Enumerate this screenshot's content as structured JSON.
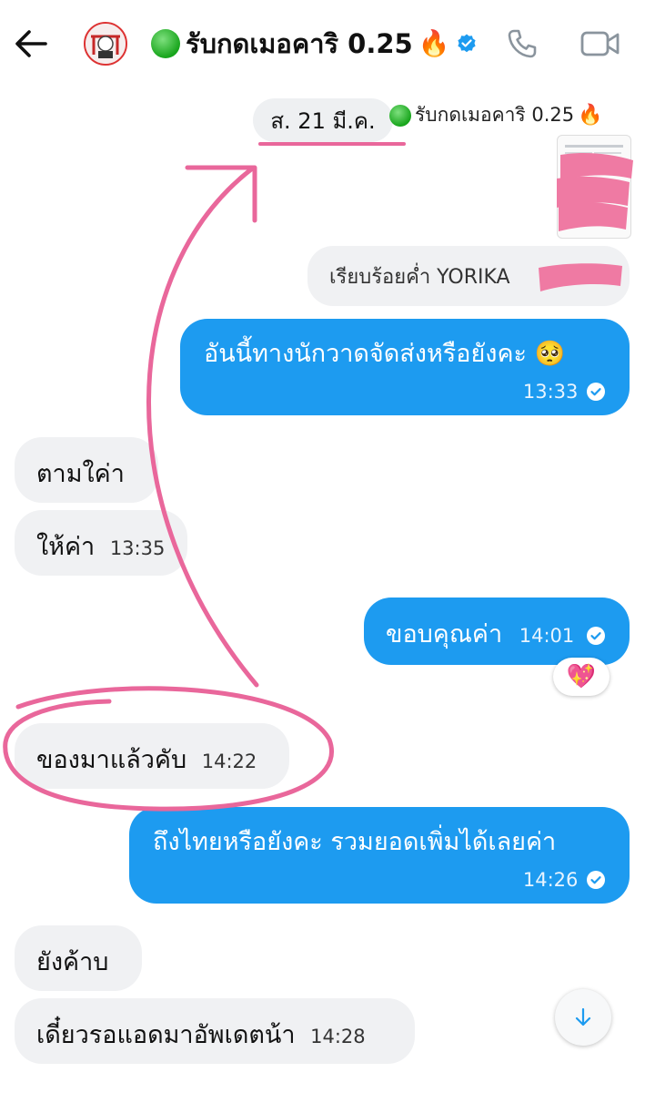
{
  "header": {
    "title": "รับกดเมอคาริ 0.25",
    "title_emoji": "🔥"
  },
  "date_separator": "ส. 21 มี.ค.",
  "shared_post": {
    "channel_name": "รับกดเมอคาริ 0.25",
    "channel_emoji": "🔥",
    "quoted_text": "เรียบร้อยค่ำ YORIKA"
  },
  "messages": [
    {
      "side": "out",
      "text": "อันนี้ทางนักวาดจัดส่งหรือยังคะ 🥺",
      "time": "13:33"
    },
    {
      "side": "in",
      "text": "ตามใค่า",
      "time": ""
    },
    {
      "side": "in",
      "text": "ให้ค่า",
      "time": "13:35"
    },
    {
      "side": "out",
      "text": "ขอบคุณค่า",
      "time": "14:01"
    },
    {
      "side": "in",
      "text": "ของมาแล้วคับ",
      "time": "14:22"
    },
    {
      "side": "out",
      "text": "ถึงไทยหรือยังคะ รวมยอดเพิ่มได้เลยค่า",
      "time": "14:26"
    },
    {
      "side": "in",
      "text": "ยังค้าบ",
      "time": ""
    },
    {
      "side": "in",
      "text": "เดี๋ยวรอแอดมาอัพเดตน้า",
      "time": "14:28"
    }
  ],
  "reaction": "💖",
  "colors": {
    "accent_blue": "#1d9bf0",
    "incoming_bubble": "#f0f1f3",
    "annotation_pink": "#e9679b"
  },
  "icons": [
    "back-arrow-icon",
    "verified-badge-icon",
    "phone-icon",
    "video-camera-icon",
    "read-check-icon",
    "scroll-down-arrow-icon"
  ]
}
